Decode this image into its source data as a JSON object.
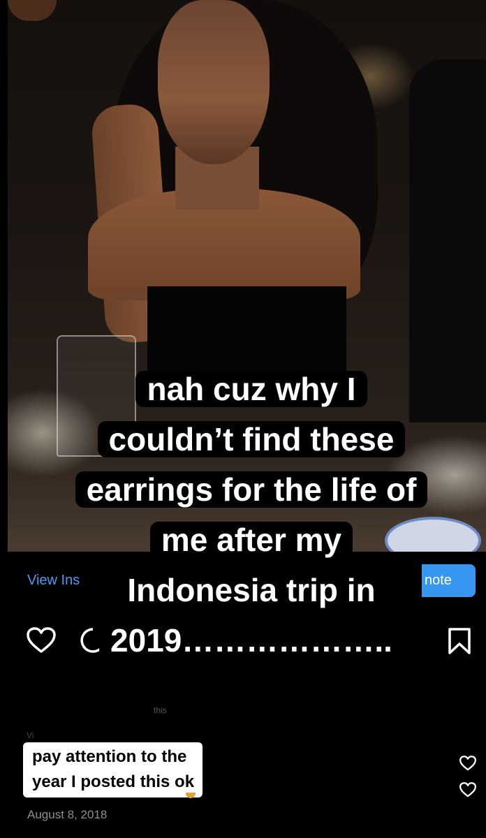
{
  "caption_overlay": {
    "lines": [
      "nah cuz why I",
      "couldn’t find these",
      "earrings for the life of",
      "me after my",
      "Indonesia trip in",
      "2019……………….."
    ]
  },
  "post": {
    "view_link": "View Ins",
    "note_button": "note",
    "faint_text_1": "this",
    "faint_text_2": "Vi",
    "date": "August 8, 2018"
  },
  "sticker": {
    "line1": "pay attention to the",
    "line2": "year I posted this ok"
  },
  "icons": {
    "like": "heart-icon",
    "comment": "comment-icon",
    "save": "bookmark-icon"
  },
  "colors": {
    "link": "#4c9bf5",
    "button": "#3797f0",
    "date": "#8e8e8e"
  }
}
